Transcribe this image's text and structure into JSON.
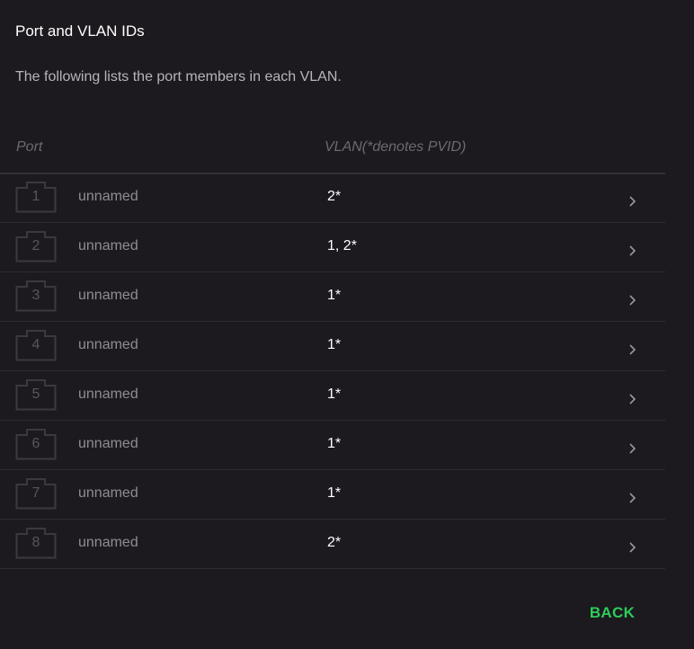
{
  "page": {
    "title": "Port and VLAN IDs",
    "description": "The following lists the port members in each VLAN."
  },
  "table": {
    "columns": {
      "port": "Port",
      "vlan": "VLAN(*denotes PVID)"
    },
    "rows": [
      {
        "port": "1",
        "name": "unnamed",
        "vlan": "2*"
      },
      {
        "port": "2",
        "name": "unnamed",
        "vlan": "1, 2*"
      },
      {
        "port": "3",
        "name": "unnamed",
        "vlan": "1*"
      },
      {
        "port": "4",
        "name": "unnamed",
        "vlan": "1*"
      },
      {
        "port": "5",
        "name": "unnamed",
        "vlan": "1*"
      },
      {
        "port": "6",
        "name": "unnamed",
        "vlan": "1*"
      },
      {
        "port": "7",
        "name": "unnamed",
        "vlan": "1*"
      },
      {
        "port": "8",
        "name": "unnamed",
        "vlan": "2*"
      }
    ]
  },
  "actions": {
    "back_label": "BACK"
  },
  "icons": {
    "port": "ethernet-port-icon",
    "row_chevron": "chevron-right-icon"
  },
  "colors": {
    "background": "#1c1a1f",
    "accent": "#2ecc5a",
    "divider": "#2e2c31"
  }
}
